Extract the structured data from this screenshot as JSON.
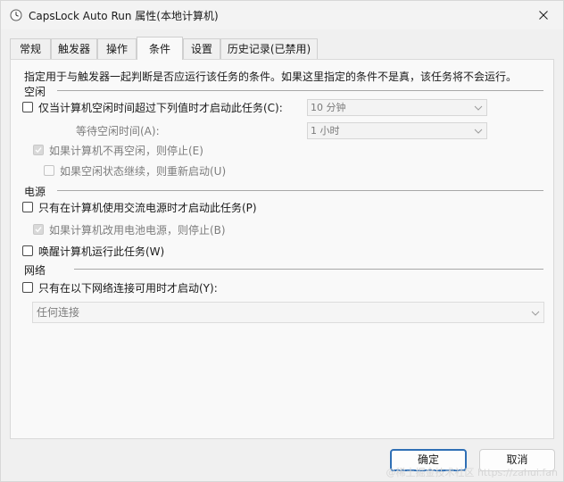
{
  "window": {
    "title": "CapsLock Auto Run 属性(本地计算机)"
  },
  "tabs": [
    {
      "label": "常规"
    },
    {
      "label": "触发器"
    },
    {
      "label": "操作"
    },
    {
      "label": "条件"
    },
    {
      "label": "设置"
    },
    {
      "label": "历史记录(已禁用)"
    }
  ],
  "conditions": {
    "intro": "指定用于与触发器一起判断是否应运行该任务的条件。如果这里指定的条件不是真，该任务将不会运行。",
    "idle": {
      "group_label": "空闲",
      "start_if_idle_label": "仅当计算机空闲时间超过下列值时才启动此任务(C):",
      "idle_duration_value": "10 分钟",
      "wait_for_idle_label": "等待空闲时间(A):",
      "wait_for_idle_value": "1 小时",
      "stop_if_not_idle_label": "如果计算机不再空闲，则停止(E)",
      "restart_if_idle_resumes_label": "如果空闲状态继续，则重新启动(U)"
    },
    "power": {
      "group_label": "电源",
      "ac_power_only_label": "只有在计算机使用交流电源时才启动此任务(P)",
      "stop_on_battery_label": "如果计算机改用电池电源，则停止(B)",
      "wake_to_run_label": "唤醒计算机运行此任务(W)"
    },
    "network": {
      "group_label": "网络",
      "network_only_label": "只有在以下网络连接可用时才启动(Y):",
      "connection_value": "任何连接"
    }
  },
  "buttons": {
    "ok_label": "确定",
    "cancel_label": "取消"
  },
  "watermark": "@稀土掘金技术社区 https://zahui.fan"
}
